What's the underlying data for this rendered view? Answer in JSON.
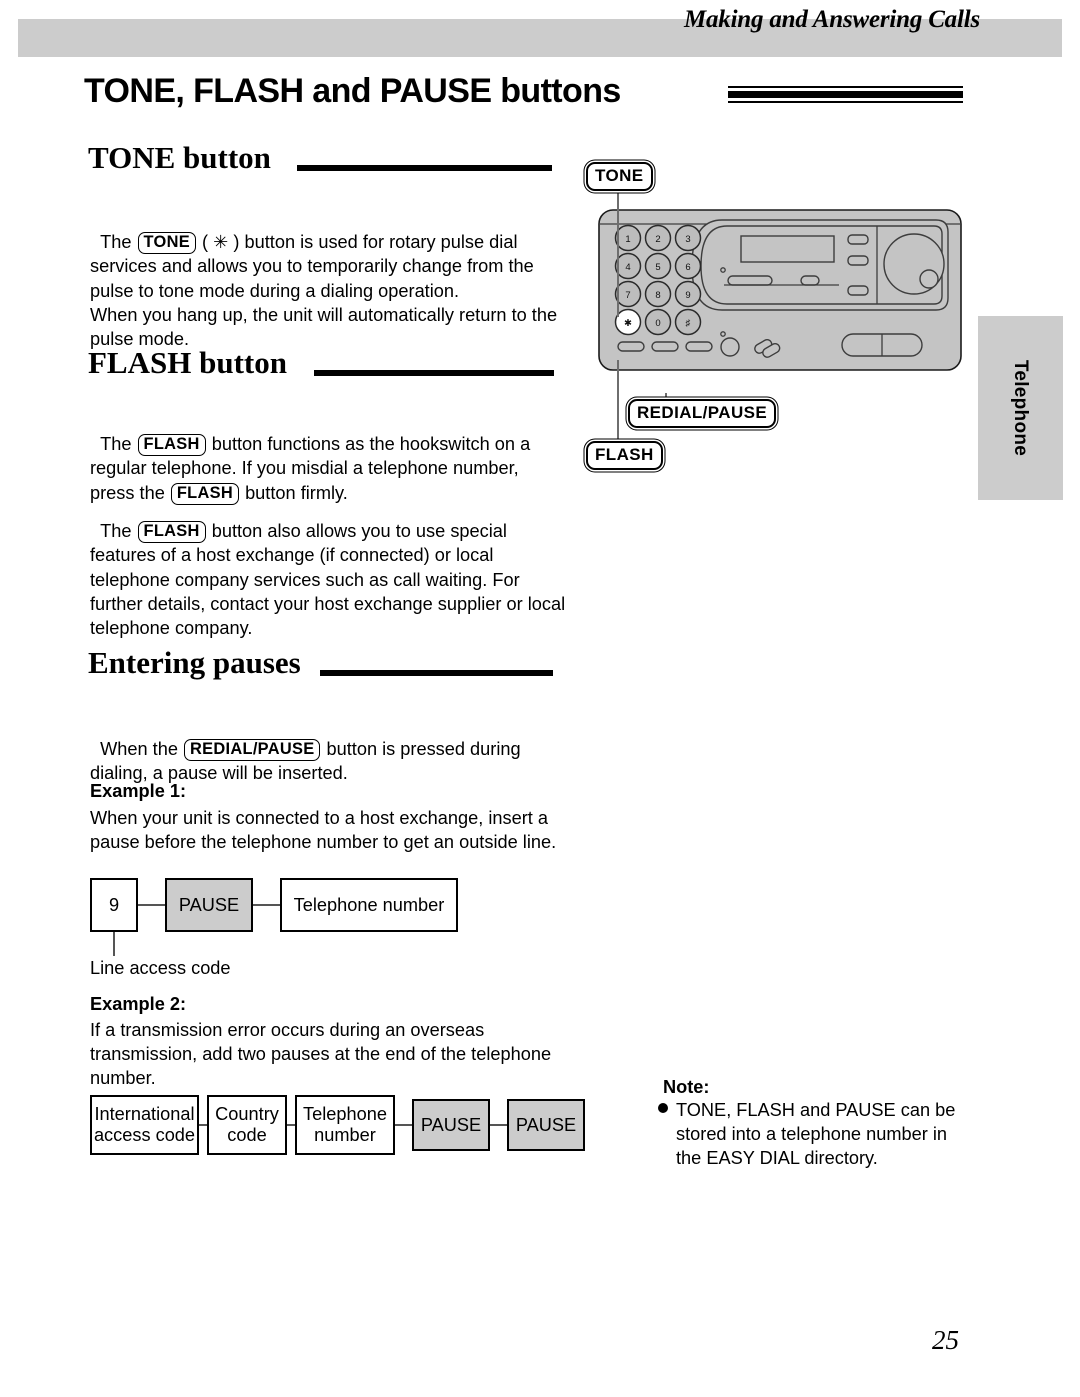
{
  "header": {
    "running_title": "Making and Answering Calls"
  },
  "page_title": "TONE, FLASH and PAUSE buttons",
  "sections": {
    "tone": {
      "heading": "TONE button",
      "body_parts": [
        "The ",
        "TONE",
        " ( ✳ ) button is used for rotary pulse dial services and allows you to temporarily change from the pulse to tone mode during a dialing operation.\nWhen you hang up, the unit will automatically return to the pulse mode."
      ]
    },
    "flash": {
      "heading": "FLASH button",
      "p1_parts": [
        "The ",
        "FLASH",
        " button functions as the hookswitch on a regular telephone. If you misdial a telephone number, press the ",
        "FLASH",
        " button firmly."
      ],
      "p2_parts": [
        "The ",
        "FLASH",
        " button also allows you to use special features of a host exchange (if connected) or local telephone company services such as call waiting. For further details, contact your host exchange supplier or local telephone company."
      ]
    },
    "pauses": {
      "heading": "Entering pauses",
      "intro_parts": [
        "When the ",
        "REDIAL/PAUSE",
        " button is pressed during dialing, a pause will be inserted."
      ],
      "example1": {
        "label": "Example 1:",
        "text": "When your unit is connected to a host exchange, insert a pause before the telephone number to get an outside line.",
        "boxes": [
          {
            "text": "9",
            "shaded": false
          },
          {
            "text": "PAUSE",
            "shaded": true
          },
          {
            "text": "Telephone number",
            "shaded": false
          }
        ],
        "caption": "Line access code"
      },
      "example2": {
        "label": "Example 2:",
        "text": "If a transmission error occurs during an overseas transmission, add two pauses at the end of the telephone number.",
        "boxes": [
          {
            "text": "International\naccess code",
            "shaded": false
          },
          {
            "text": "Country\ncode",
            "shaded": false
          },
          {
            "text": "Telephone\nnumber",
            "shaded": false
          },
          {
            "text": "PAUSE",
            "shaded": true
          },
          {
            "text": "PAUSE",
            "shaded": true
          }
        ]
      }
    }
  },
  "note": {
    "label": "Note:",
    "text": "TONE, FLASH and PAUSE can be stored into a telephone number in the EASY DIAL directory."
  },
  "illustration": {
    "callouts": {
      "tone": "TONE",
      "redial_pause": "REDIAL/PAUSE",
      "flash": "FLASH"
    },
    "keypad": [
      "1",
      "2",
      "3",
      "4",
      "5",
      "6",
      "7",
      "8",
      "9",
      "✳",
      "0",
      "#"
    ]
  },
  "side_tab": {
    "label": "Telephone"
  },
  "page_number": "25",
  "colors": {
    "band_gray": "#cccccc",
    "box_shade": "#cccccc",
    "device_body": "#c0c0c0",
    "ink": "#000000"
  }
}
